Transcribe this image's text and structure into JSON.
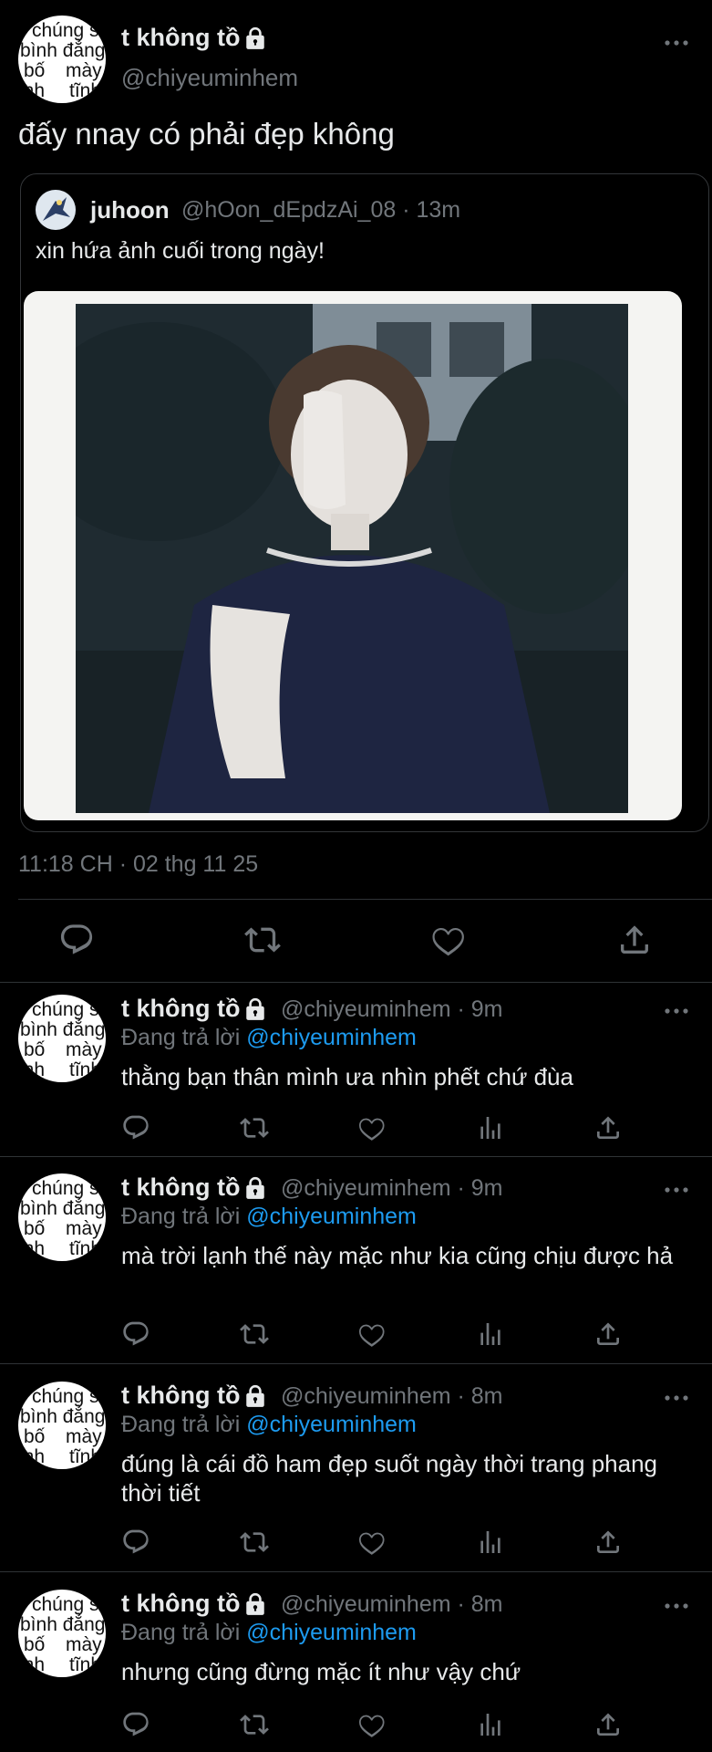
{
  "main_tweet": {
    "display_name": "t không tồ",
    "handle": "@chiyeuminhem",
    "text": "đấy nnay có phải đẹp không",
    "timestamp": "11:18 CH · 02 thg 11 25",
    "avatar_text": [
      "chúng sin",
      "bình đẳng",
      "bố",
      "mày",
      "anh",
      "tĩnh"
    ]
  },
  "quoted_tweet": {
    "display_name": "juhoon",
    "handle_time": "@hOon_dEpdzAi_08 · 13m",
    "text": "xin hứa ảnh cuối trong ngày!"
  },
  "icons": [
    "more-icon",
    "lock-icon",
    "reply-icon",
    "retweet-icon",
    "like-icon",
    "share-icon",
    "analytics-icon"
  ],
  "replies": [
    {
      "display_name": "t không tồ",
      "handle_time": "@chiyeuminhem · 9m",
      "replying_prefix": "Đang trả lời",
      "replying_to": "@chiyeuminhem",
      "text": "thằng bạn thân mình ưa nhìn phết chứ đùa"
    },
    {
      "display_name": "t không tồ",
      "handle_time": "@chiyeuminhem · 9m",
      "replying_prefix": "Đang trả lời",
      "replying_to": "@chiyeuminhem",
      "text": "mà trời lạnh thế này mặc như kia cũng chịu được hả"
    },
    {
      "display_name": "t không tồ",
      "handle_time": "@chiyeuminhem · 8m",
      "replying_prefix": "Đang trả lời",
      "replying_to": "@chiyeuminhem",
      "text": "đúng là cái đồ ham đẹp suốt ngày thời trang phang thời tiết"
    },
    {
      "display_name": "t không tồ",
      "handle_time": "@chiyeuminhem · 8m",
      "replying_prefix": "Đang trả lời",
      "replying_to": "@chiyeuminhem",
      "text": "nhưng cũng đừng mặc ít như vậy chứ"
    }
  ],
  "colors": {
    "background": "#000000",
    "text": "#e7e9ea",
    "muted": "#71767b",
    "link": "#1d9bf0",
    "divider": "#2f3336"
  }
}
